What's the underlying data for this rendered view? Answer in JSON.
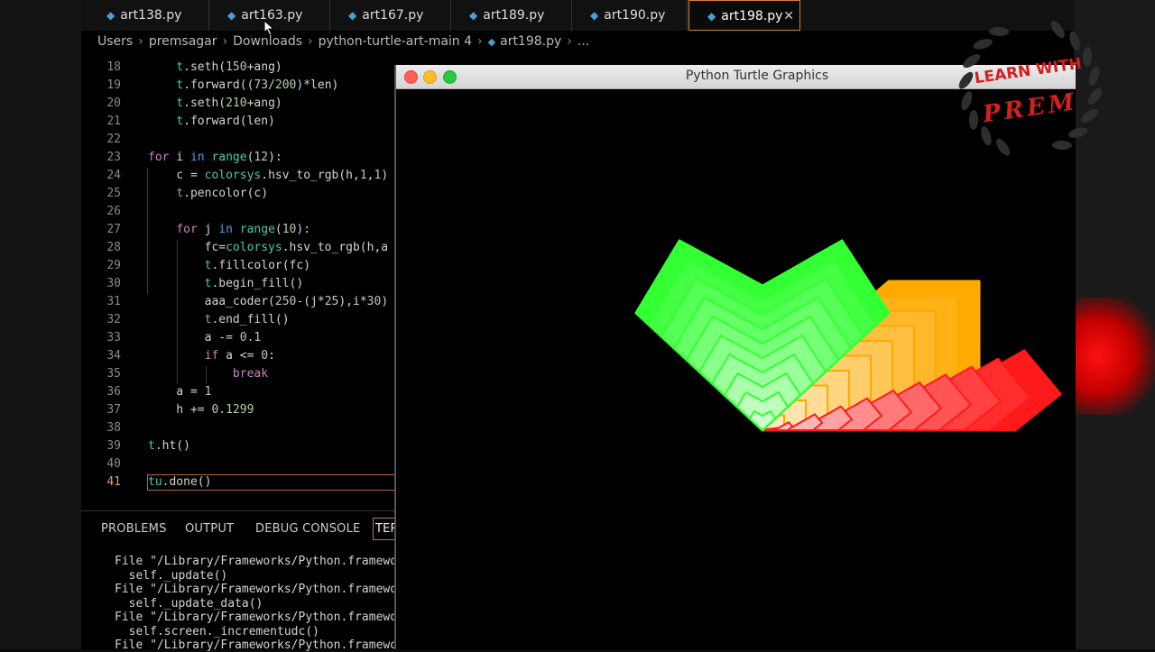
{
  "tabs": [
    {
      "label": "art138.py",
      "active": false
    },
    {
      "label": "art163.py",
      "active": false
    },
    {
      "label": "art167.py",
      "active": false
    },
    {
      "label": "art189.py",
      "active": false
    },
    {
      "label": "art190.py",
      "active": false
    },
    {
      "label": "art198.py",
      "active": true
    }
  ],
  "tab_close_glyph": "✕",
  "breadcrumb": [
    "Users",
    "premsagar",
    "Downloads",
    "python-turtle-art-main 4",
    "art198.py",
    "..."
  ],
  "code": {
    "line_numbers": [
      "18",
      "19",
      "20",
      "21",
      "22",
      "23",
      "24",
      "25",
      "26",
      "27",
      "28",
      "29",
      "30",
      "31",
      "32",
      "33",
      "34",
      "35",
      "36",
      "37",
      "38",
      "39",
      "40",
      "41"
    ],
    "current_line": "41"
  },
  "panel": {
    "tabs": [
      "PROBLEMS",
      "OUTPUT",
      "DEBUG CONSOLE",
      "TER"
    ],
    "terminal_lines": [
      "File \"/Library/Frameworks/Python.framewo",
      "  self._update()",
      "File \"/Library/Frameworks/Python.framewo",
      "  self._update_data()",
      "File \"/Library/Frameworks/Python.framewo",
      "  self.screen._incrementudc()",
      "File \"/Library/Frameworks/Python.framewo"
    ]
  },
  "turtle_window": {
    "title": "Python Turtle Graphics"
  },
  "logo": {
    "line1": "LEARN WITH",
    "line2": "PREM"
  },
  "colors": {
    "accent_orange": "#d97b3c",
    "green": "#33ff33",
    "orange": "#ffaa00",
    "red": "#ff1a1a"
  }
}
